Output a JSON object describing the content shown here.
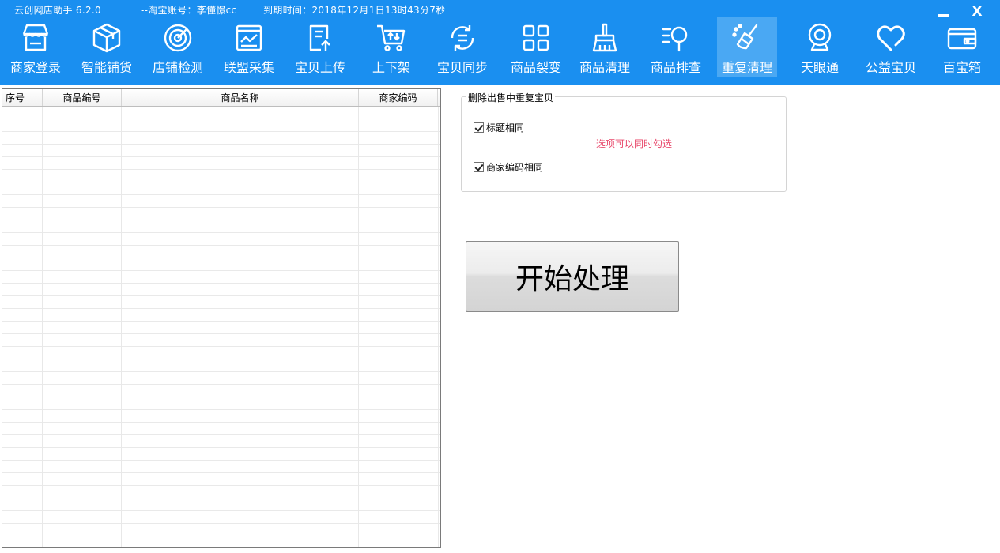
{
  "window": {
    "app_title": "云创网店助手  6.2.0",
    "account": "--淘宝账号：李懂憬cc",
    "expiry": "到期时间：2018年12月1日13时43分7秒",
    "minimize": "—",
    "close": "X"
  },
  "toolbar": {
    "items": [
      {
        "label": "商家登录",
        "icon": "store-icon"
      },
      {
        "label": "智能铺货",
        "icon": "box-icon"
      },
      {
        "label": "店铺检测",
        "icon": "radar-icon"
      },
      {
        "label": "联盟采集",
        "icon": "chart-window-icon"
      },
      {
        "label": "宝贝上传",
        "icon": "document-upload-icon"
      },
      {
        "label": "上下架",
        "icon": "cart-icon"
      },
      {
        "label": "宝贝同步",
        "icon": "sync-icon"
      },
      {
        "label": "商品裂变",
        "icon": "grid-icon"
      },
      {
        "label": "商品清理",
        "icon": "broom-icon"
      },
      {
        "label": "商品排查",
        "icon": "search-list-icon"
      },
      {
        "label": "重复清理",
        "icon": "sweep-icon",
        "active": true
      },
      {
        "label": "天眼通",
        "icon": "webcam-icon"
      },
      {
        "label": "公益宝贝",
        "icon": "heart-icon"
      },
      {
        "label": "百宝箱",
        "icon": "wallet-icon"
      }
    ],
    "text_color": "#ffffff",
    "background": "#1a8ff0",
    "active_background": "#4aa8f3"
  },
  "grid": {
    "columns": [
      "序号",
      "商品编号",
      "商品名称",
      "商家编码"
    ],
    "rows": []
  },
  "options": {
    "group_title": "删除出售中重复宝贝",
    "title_same": {
      "label": "标题相同",
      "checked": true
    },
    "code_same": {
      "label": "商家编码相同",
      "checked": true
    },
    "hint": "选项可以同时勾选",
    "hint_color": "#e8476a"
  },
  "actions": {
    "start_label": "开始处理"
  }
}
